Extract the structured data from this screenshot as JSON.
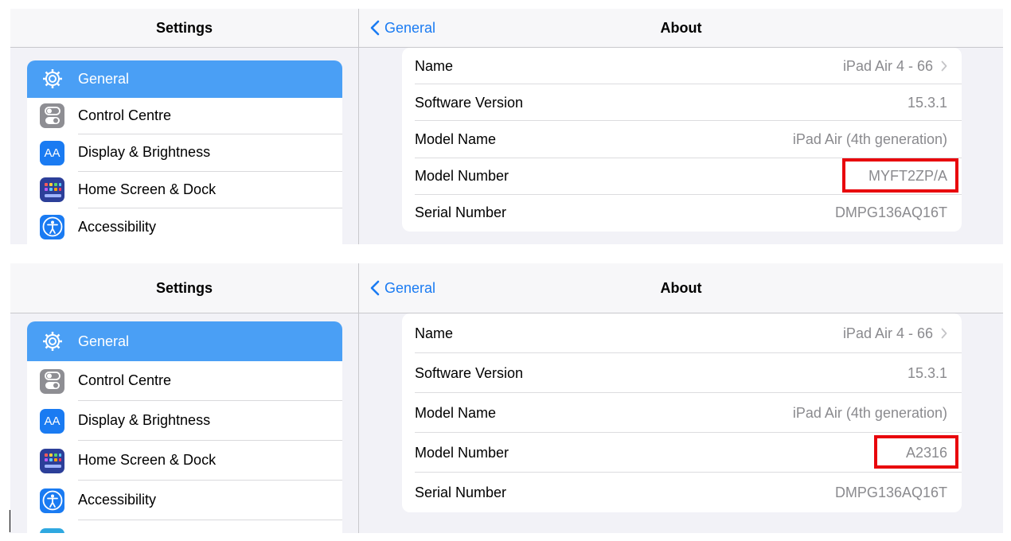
{
  "screens": [
    {
      "sidebar": {
        "title": "Settings",
        "items": [
          {
            "label": "General",
            "icon": "gear-icon",
            "selected": true
          },
          {
            "label": "Control Centre",
            "icon": "toggles-icon"
          },
          {
            "label": "Display & Brightness",
            "icon": "text-size-icon"
          },
          {
            "label": "Home Screen & Dock",
            "icon": "app-grid-icon"
          },
          {
            "label": "Accessibility",
            "icon": "accessibility-icon"
          }
        ]
      },
      "detail": {
        "back_label": "General",
        "title": "About",
        "rows": [
          {
            "key": "Name",
            "value": "iPad Air 4 - 66"
          },
          {
            "key": "Software Version",
            "value": "15.3.1"
          },
          {
            "key": "Model Name",
            "value": "iPad Air (4th generation)"
          },
          {
            "key": "Model Number",
            "value": "MYFT2ZP/A"
          },
          {
            "key": "Serial Number",
            "value": "DMPG136AQ16T"
          }
        ]
      }
    },
    {
      "sidebar": {
        "title": "Settings",
        "items": [
          {
            "label": "General",
            "icon": "gear-icon",
            "selected": true
          },
          {
            "label": "Control Centre",
            "icon": "toggles-icon"
          },
          {
            "label": "Display & Brightness",
            "icon": "text-size-icon"
          },
          {
            "label": "Home Screen & Dock",
            "icon": "app-grid-icon"
          },
          {
            "label": "Accessibility",
            "icon": "accessibility-icon"
          }
        ]
      },
      "detail": {
        "back_label": "General",
        "title": "About",
        "rows": [
          {
            "key": "Name",
            "value": "iPad Air 4 - 66"
          },
          {
            "key": "Software Version",
            "value": "15.3.1"
          },
          {
            "key": "Model Name",
            "value": "iPad Air (4th generation)"
          },
          {
            "key": "Model Number",
            "value": "A2316"
          },
          {
            "key": "Serial Number",
            "value": "DMPG136AQ16T"
          }
        ]
      }
    }
  ],
  "icon_labels": {
    "text_size": "AA"
  },
  "colors": {
    "accent": "#1a7bf2",
    "selected_row": "#4a9ff5",
    "highlight": "#e8060c",
    "secondary_text": "#8a8a8e"
  }
}
